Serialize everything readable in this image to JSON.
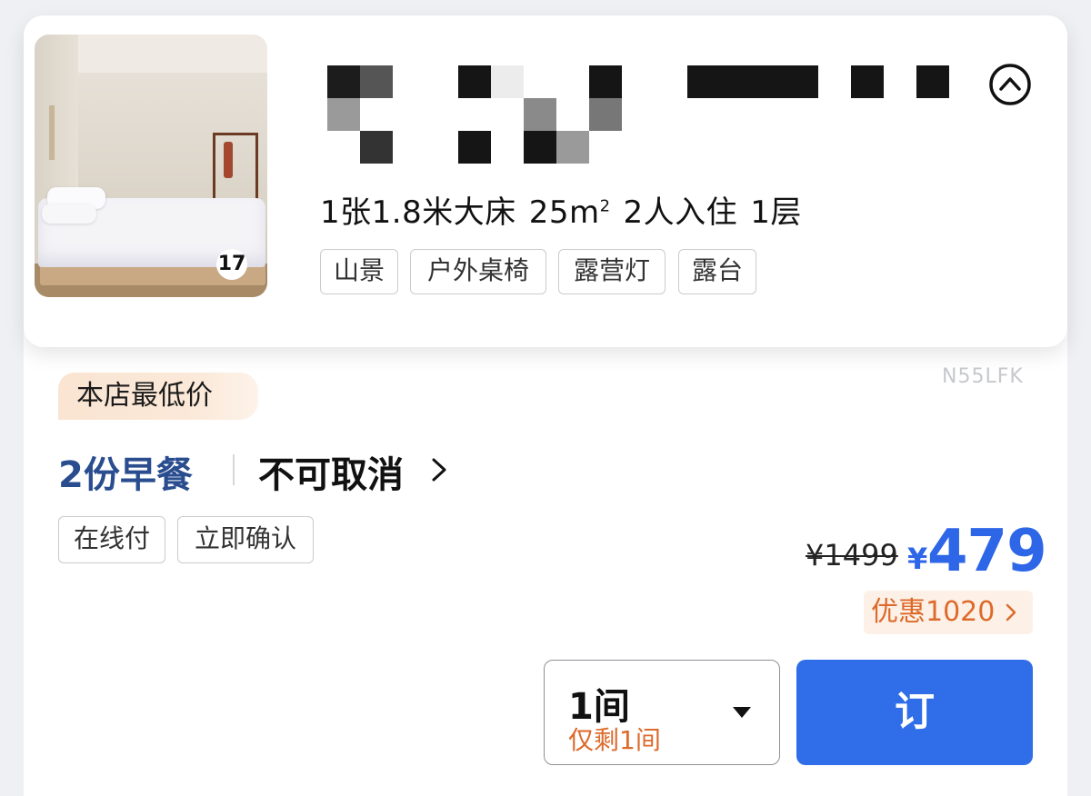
{
  "room": {
    "photo_count": "17",
    "specs": {
      "bed": "1张1.8米大床",
      "area_value": "25m",
      "area_sup": "2",
      "occupancy": "2人入住",
      "floor": "1层"
    },
    "amenities": [
      "山景",
      "户外桌椅",
      "露营灯",
      "露台"
    ]
  },
  "offer": {
    "badge": "本店最低价",
    "rate_code": "N55LFK",
    "meal_plan": "2份早餐",
    "cancel_policy": "不可取消",
    "tags": [
      "在线付",
      "立即确认"
    ],
    "original_price": "¥1499",
    "currency": "¥",
    "price": "479",
    "discount": "优惠1020",
    "room_qty": "1间",
    "rooms_left": "仅剩1间",
    "book_label": "订"
  },
  "colors": {
    "accent_blue": "#2f6ee8",
    "meal_blue": "#2a4d8f",
    "discount_orange": "#dd6a2b"
  },
  "icons": {
    "collapse": "chevron-up-circle-icon",
    "cancel_more": "chevron-right-icon",
    "discount_more": "chevron-right-icon",
    "dropdown": "caret-down-icon"
  }
}
